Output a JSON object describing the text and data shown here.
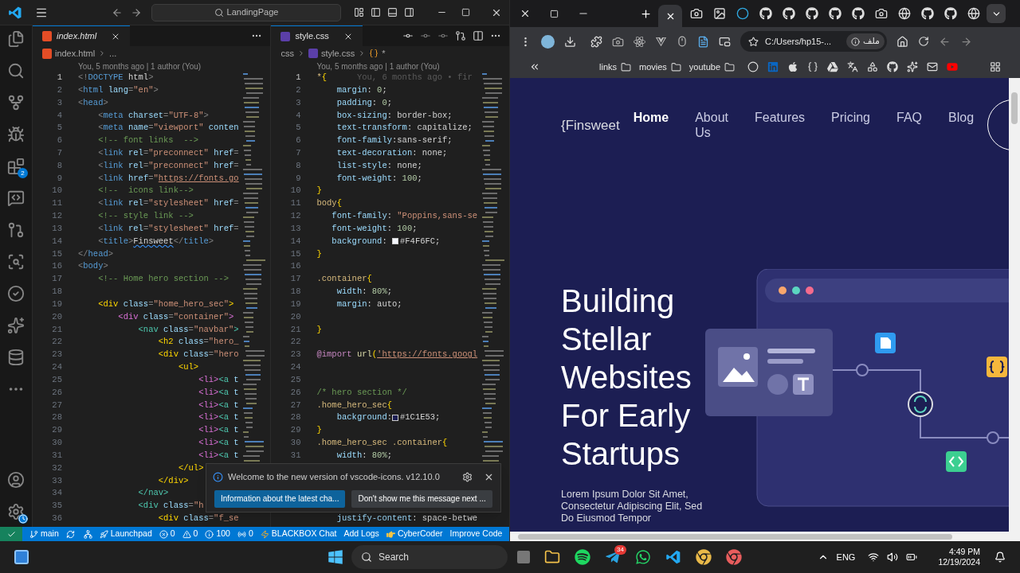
{
  "vscode": {
    "title_search": "LandingPage",
    "extensions_badge": "2",
    "editors": [
      {
        "tab": {
          "label": "index.html",
          "preview": true,
          "kind": "html"
        },
        "breadcrumb": [
          "index.html",
          "..."
        ],
        "blame": "You, 5 months ago | 1 author (You)",
        "lines": [
          {
            "n": "1",
            "current": true,
            "tokens": [
              {
                "kind": "p",
                "t": "<!"
              },
              {
                "kind": "tag",
                "t": "DOCTYPE"
              },
              {
                "kind": "tx",
                "t": " html"
              },
              {
                "kind": "p",
                "t": ">"
              }
            ]
          },
          {
            "n": "2",
            "current": false,
            "tokens": [
              {
                "kind": "p",
                "t": "<"
              },
              {
                "kind": "tag",
                "t": "html"
              },
              {
                "kind": "attr",
                "t": " lang"
              },
              {
                "kind": "p",
                "t": "="
              },
              {
                "kind": "str",
                "t": "\"en\""
              },
              {
                "kind": "p",
                "t": ">"
              }
            ]
          },
          {
            "n": "3",
            "current": false,
            "tokens": [
              {
                "kind": "p",
                "t": "<"
              },
              {
                "kind": "tag",
                "t": "head"
              },
              {
                "kind": "p",
                "t": ">"
              }
            ]
          },
          {
            "n": "4",
            "current": false,
            "tokens": [
              {
                "kind": "p",
                "t": "    <"
              },
              {
                "kind": "tag",
                "t": "meta"
              },
              {
                "kind": "attr",
                "t": " charset"
              },
              {
                "kind": "p",
                "t": "="
              },
              {
                "kind": "str",
                "t": "\"UTF-8\""
              },
              {
                "kind": "p",
                "t": ">"
              }
            ]
          },
          {
            "n": "5",
            "current": false,
            "tokens": [
              {
                "kind": "p",
                "t": "    <"
              },
              {
                "kind": "tag",
                "t": "meta"
              },
              {
                "kind": "attr",
                "t": " name"
              },
              {
                "kind": "p",
                "t": "="
              },
              {
                "kind": "str",
                "t": "\"viewport\""
              },
              {
                "kind": "attr",
                "t": " conten"
              }
            ]
          },
          {
            "n": "6",
            "current": false,
            "tokens": [
              {
                "kind": "cm",
                "t": "    <!-- font links  -->"
              }
            ]
          },
          {
            "n": "7",
            "current": false,
            "tokens": [
              {
                "kind": "p",
                "t": "    <"
              },
              {
                "kind": "tag",
                "t": "link"
              },
              {
                "kind": "attr",
                "t": " rel"
              },
              {
                "kind": "p",
                "t": "="
              },
              {
                "kind": "str",
                "t": "\"preconnect\""
              },
              {
                "kind": "attr",
                "t": " href"
              },
              {
                "kind": "p",
                "t": "="
              }
            ]
          },
          {
            "n": "8",
            "current": false,
            "tokens": [
              {
                "kind": "p",
                "t": "    <"
              },
              {
                "kind": "tag",
                "t": "link"
              },
              {
                "kind": "attr",
                "t": " rel"
              },
              {
                "kind": "p",
                "t": "="
              },
              {
                "kind": "str",
                "t": "\"preconnect\""
              },
              {
                "kind": "attr",
                "t": " href"
              },
              {
                "kind": "p",
                "t": "="
              }
            ]
          },
          {
            "n": "9",
            "current": false,
            "tokens": [
              {
                "kind": "p",
                "t": "    <"
              },
              {
                "kind": "tag",
                "t": "link"
              },
              {
                "kind": "attr",
                "t": " href"
              },
              {
                "kind": "p",
                "t": "="
              },
              {
                "kind": "str",
                "t": "\""
              },
              {
                "kind": "url",
                "t": "https://fonts.go"
              }
            ]
          },
          {
            "n": "10",
            "current": false,
            "tokens": [
              {
                "kind": "cm",
                "t": "    <!--  icons link-->"
              }
            ]
          },
          {
            "n": "11",
            "current": false,
            "tokens": [
              {
                "kind": "p",
                "t": "    <"
              },
              {
                "kind": "tag",
                "t": "link"
              },
              {
                "kind": "attr",
                "t": " rel"
              },
              {
                "kind": "p",
                "t": "="
              },
              {
                "kind": "str",
                "t": "\"stylesheet\""
              },
              {
                "kind": "attr",
                "t": " href"
              },
              {
                "kind": "p",
                "t": "="
              }
            ]
          },
          {
            "n": "12",
            "current": false,
            "tokens": [
              {
                "kind": "cm",
                "t": "    <!-- style link -->"
              }
            ]
          },
          {
            "n": "13",
            "current": false,
            "tokens": [
              {
                "kind": "p",
                "t": "    <"
              },
              {
                "kind": "tag",
                "t": "link"
              },
              {
                "kind": "attr",
                "t": " rel"
              },
              {
                "kind": "p",
                "t": "="
              },
              {
                "kind": "str",
                "t": "\"stylesheet\""
              },
              {
                "kind": "attr",
                "t": " href"
              },
              {
                "kind": "p",
                "t": "="
              }
            ]
          },
          {
            "n": "14",
            "current": false,
            "tokens": [
              {
                "kind": "p",
                "t": "    <"
              },
              {
                "kind": "tag",
                "t": "title"
              },
              {
                "kind": "p",
                "t": ">"
              },
              {
                "kind": "sq",
                "t": "Finsweet"
              },
              {
                "kind": "p",
                "t": "</"
              },
              {
                "kind": "tag",
                "t": "title"
              },
              {
                "kind": "p",
                "t": ">"
              }
            ]
          },
          {
            "n": "15",
            "current": false,
            "tokens": [
              {
                "kind": "p",
                "t": "</"
              },
              {
                "kind": "tag",
                "t": "head"
              },
              {
                "kind": "p",
                "t": ">"
              }
            ]
          },
          {
            "n": "16",
            "current": false,
            "tokens": [
              {
                "kind": "p",
                "t": "<"
              },
              {
                "kind": "tag",
                "t": "body"
              },
              {
                "kind": "p",
                "t": ">"
              }
            ]
          },
          {
            "n": "17",
            "current": false,
            "tokens": [
              {
                "kind": "cm",
                "t": "    <!-- Home hero section -->"
              }
            ]
          },
          {
            "n": "18",
            "current": false
          },
          {
            "n": "19",
            "current": false,
            "tokens": [
              {
                "kind": "gold",
                "t": "    <div"
              },
              {
                "kind": "attr",
                "t": " class"
              },
              {
                "kind": "p",
                "t": "="
              },
              {
                "kind": "str",
                "t": "\"home_hero_sec\""
              },
              {
                "kind": "gold",
                "t": ">"
              }
            ]
          },
          {
            "n": "20",
            "current": false,
            "tokens": [
              {
                "kind": "orch",
                "t": "        <div"
              },
              {
                "kind": "attr",
                "t": " class"
              },
              {
                "kind": "p",
                "t": "="
              },
              {
                "kind": "str",
                "t": "\"container\""
              },
              {
                "kind": "orch",
                "t": ">"
              }
            ]
          },
          {
            "n": "21",
            "current": false,
            "tokens": [
              {
                "kind": "teal",
                "t": "            <nav"
              },
              {
                "kind": "attr",
                "t": " class"
              },
              {
                "kind": "p",
                "t": "="
              },
              {
                "kind": "str",
                "t": "\"navbar\""
              },
              {
                "kind": "teal",
                "t": ">"
              }
            ]
          },
          {
            "n": "22",
            "current": false,
            "tokens": [
              {
                "kind": "gold",
                "t": "                <h2"
              },
              {
                "kind": "attr",
                "t": " class"
              },
              {
                "kind": "p",
                "t": "="
              },
              {
                "kind": "str",
                "t": "\"hero_"
              }
            ]
          },
          {
            "n": "23",
            "current": false,
            "tokens": [
              {
                "kind": "gold",
                "t": "                <div"
              },
              {
                "kind": "attr",
                "t": " class"
              },
              {
                "kind": "p",
                "t": "="
              },
              {
                "kind": "str",
                "t": "\"hero"
              }
            ]
          },
          {
            "n": "24",
            "current": false,
            "tokens": [
              {
                "kind": "gold",
                "t": "                    <ul>"
              }
            ]
          },
          {
            "n": "25",
            "current": false,
            "tokens": [
              {
                "kind": "orch",
                "t": "                        <li>"
              },
              {
                "kind": "teal",
                "t": "<a"
              },
              {
                "kind": "attr",
                "t": " t"
              }
            ]
          },
          {
            "n": "26",
            "current": false,
            "tokens": [
              {
                "kind": "orch",
                "t": "                        <li>"
              },
              {
                "kind": "teal",
                "t": "<a"
              },
              {
                "kind": "attr",
                "t": " t"
              }
            ]
          },
          {
            "n": "27",
            "current": false,
            "tokens": [
              {
                "kind": "orch",
                "t": "                        <li>"
              },
              {
                "kind": "teal",
                "t": "<a"
              },
              {
                "kind": "attr",
                "t": " t"
              }
            ]
          },
          {
            "n": "28",
            "current": false,
            "tokens": [
              {
                "kind": "orch",
                "t": "                        <li>"
              },
              {
                "kind": "teal",
                "t": "<a"
              },
              {
                "kind": "attr",
                "t": " t"
              }
            ]
          },
          {
            "n": "29",
            "current": false,
            "tokens": [
              {
                "kind": "orch",
                "t": "                        <li>"
              },
              {
                "kind": "teal",
                "t": "<a"
              },
              {
                "kind": "attr",
                "t": " t"
              }
            ]
          },
          {
            "n": "30",
            "current": false,
            "tokens": [
              {
                "kind": "orch",
                "t": "                        <li>"
              },
              {
                "kind": "teal",
                "t": "<a"
              },
              {
                "kind": "attr",
                "t": " t"
              }
            ]
          },
          {
            "n": "31",
            "current": false,
            "tokens": [
              {
                "kind": "orch",
                "t": "                        <li>"
              },
              {
                "kind": "teal",
                "t": "<a"
              },
              {
                "kind": "attr",
                "t": " t"
              }
            ]
          },
          {
            "n": "32",
            "current": false,
            "tokens": [
              {
                "kind": "gold",
                "t": "                    </ul>"
              }
            ]
          },
          {
            "n": "33",
            "current": false,
            "tokens": [
              {
                "kind": "gold",
                "t": "                </div>"
              }
            ]
          },
          {
            "n": "34",
            "current": false,
            "tokens": [
              {
                "kind": "teal",
                "t": "            </nav>"
              }
            ]
          },
          {
            "n": "35",
            "current": false,
            "tokens": [
              {
                "kind": "teal",
                "t": "            <div"
              },
              {
                "kind": "attr",
                "t": " class"
              },
              {
                "kind": "p",
                "t": "="
              },
              {
                "kind": "str",
                "t": "\"h"
              }
            ]
          },
          {
            "n": "36",
            "current": false,
            "tokens": [
              {
                "kind": "gold",
                "t": "                <div"
              },
              {
                "kind": "attr",
                "t": " class"
              },
              {
                "kind": "p",
                "t": "="
              },
              {
                "kind": "str",
                "t": "\"f_se"
              }
            ]
          }
        ]
      },
      {
        "tab": {
          "label": "style.css",
          "preview": false,
          "kind": "css"
        },
        "breadcrumb": [
          "css",
          "style.css",
          "*"
        ],
        "blame": "You, 5 months ago | 1 author (You)",
        "lines": [
          {
            "n": "1",
            "current": true,
            "tokens": [
              {
                "kind": "sel",
                "t": "*"
              },
              {
                "kind": "gold",
                "t": "{"
              },
              {
                "kind": "ghost",
                "t": "      You, 6 months ago • fir"
              }
            ]
          },
          {
            "n": "2",
            "current": false,
            "tokens": [
              {
                "kind": "prop",
                "t": "    margin"
              },
              {
                "kind": "tx",
                "t": ": "
              },
              {
                "kind": "num",
                "t": "0"
              },
              {
                "kind": "tx",
                "t": ";"
              }
            ]
          },
          {
            "n": "3",
            "current": false,
            "tokens": [
              {
                "kind": "prop",
                "t": "    padding"
              },
              {
                "kind": "tx",
                "t": ": "
              },
              {
                "kind": "num",
                "t": "0"
              },
              {
                "kind": "tx",
                "t": ";"
              }
            ]
          },
          {
            "n": "4",
            "current": false,
            "tokens": [
              {
                "kind": "prop",
                "t": "    box-sizing"
              },
              {
                "kind": "tx",
                "t": ": border-box;"
              }
            ]
          },
          {
            "n": "5",
            "current": false,
            "tokens": [
              {
                "kind": "prop",
                "t": "    text-transform"
              },
              {
                "kind": "tx",
                "t": ": capitalize;"
              }
            ]
          },
          {
            "n": "6",
            "current": false,
            "tokens": [
              {
                "kind": "prop",
                "t": "    font-family"
              },
              {
                "kind": "tx",
                "t": ":sans-serif;"
              }
            ]
          },
          {
            "n": "7",
            "current": false,
            "tokens": [
              {
                "kind": "prop",
                "t": "    text-decoration"
              },
              {
                "kind": "tx",
                "t": ": none;"
              }
            ]
          },
          {
            "n": "8",
            "current": false,
            "tokens": [
              {
                "kind": "prop",
                "t": "    list-style"
              },
              {
                "kind": "tx",
                "t": ": none;"
              }
            ]
          },
          {
            "n": "9",
            "current": false,
            "tokens": [
              {
                "kind": "prop",
                "t": "    font-weight"
              },
              {
                "kind": "tx",
                "t": ": "
              },
              {
                "kind": "num",
                "t": "100"
              },
              {
                "kind": "tx",
                "t": ";"
              }
            ]
          },
          {
            "n": "10",
            "current": false,
            "tokens": [
              {
                "kind": "gold",
                "t": "}"
              }
            ]
          },
          {
            "n": "11",
            "current": false,
            "tokens": [
              {
                "kind": "sel",
                "t": "body"
              },
              {
                "kind": "gold",
                "t": "{"
              }
            ]
          },
          {
            "n": "12",
            "current": false,
            "tokens": [
              {
                "kind": "prop",
                "t": "   font-family"
              },
              {
                "kind": "tx",
                "t": ": "
              },
              {
                "kind": "str",
                "t": "\"Poppins,sans-se"
              }
            ]
          },
          {
            "n": "13",
            "current": false,
            "tokens": [
              {
                "kind": "prop",
                "t": "   font-weight"
              },
              {
                "kind": "tx",
                "t": ": "
              },
              {
                "kind": "num",
                "t": "100"
              },
              {
                "kind": "tx",
                "t": ";"
              }
            ]
          },
          {
            "n": "14",
            "current": false,
            "tokens": [
              {
                "kind": "prop",
                "t": "   background"
              },
              {
                "kind": "tx",
                "t": ": "
              },
              {
                "kind": "swatch",
                "t": "#F4F6FC",
                "color": "#f4f6fc"
              },
              {
                "kind": "tx",
                "t": ";"
              }
            ]
          },
          {
            "n": "15",
            "current": false,
            "tokens": [
              {
                "kind": "gold",
                "t": "}"
              }
            ]
          },
          {
            "n": "16",
            "current": false
          },
          {
            "n": "17",
            "current": false,
            "tokens": [
              {
                "kind": "sel",
                "t": ".container"
              },
              {
                "kind": "gold",
                "t": "{"
              }
            ]
          },
          {
            "n": "18",
            "current": false,
            "tokens": [
              {
                "kind": "prop",
                "t": "    width"
              },
              {
                "kind": "tx",
                "t": ": "
              },
              {
                "kind": "num",
                "t": "80%"
              },
              {
                "kind": "tx",
                "t": ";"
              }
            ]
          },
          {
            "n": "19",
            "current": false,
            "tokens": [
              {
                "kind": "prop",
                "t": "    margin"
              },
              {
                "kind": "tx",
                "t": ": auto;"
              }
            ]
          },
          {
            "n": "20",
            "current": false
          },
          {
            "n": "21",
            "current": false,
            "tokens": [
              {
                "kind": "gold",
                "t": "}"
              }
            ]
          },
          {
            "n": "22",
            "current": false
          },
          {
            "n": "23",
            "current": false,
            "tokens": [
              {
                "kind": "kw",
                "t": "@import"
              },
              {
                "kind": "fn",
                "t": " url"
              },
              {
                "kind": "gold",
                "t": "("
              },
              {
                "kind": "url",
                "t": "'https://fonts.googl"
              }
            ]
          },
          {
            "n": "24",
            "current": false
          },
          {
            "n": "25",
            "current": false
          },
          {
            "n": "26",
            "current": false,
            "tokens": [
              {
                "kind": "cm",
                "t": "/* hero section */"
              }
            ]
          },
          {
            "n": "27",
            "current": false,
            "tokens": [
              {
                "kind": "sel",
                "t": ".home_hero_sec"
              },
              {
                "kind": "gold",
                "t": "{"
              }
            ]
          },
          {
            "n": "28",
            "current": false,
            "tokens": [
              {
                "kind": "prop",
                "t": "    background"
              },
              {
                "kind": "tx",
                "t": ":"
              },
              {
                "kind": "swatch",
                "t": "#1C1E53",
                "color": "#1c1e53"
              },
              {
                "kind": "tx",
                "t": ";"
              }
            ]
          },
          {
            "n": "29",
            "current": false,
            "tokens": [
              {
                "kind": "gold",
                "t": "}"
              }
            ]
          },
          {
            "n": "30",
            "current": false,
            "tokens": [
              {
                "kind": "sel",
                "t": ".home_hero_sec .container"
              },
              {
                "kind": "gold",
                "t": "{"
              }
            ]
          },
          {
            "n": "31",
            "current": false,
            "tokens": [
              {
                "kind": "prop",
                "t": "    width"
              },
              {
                "kind": "tx",
                "t": ": "
              },
              {
                "kind": "num",
                "t": "80%"
              },
              {
                "kind": "tx",
                "t": ";"
              }
            ]
          }
        ],
        "partial_line": [
          {
            "kind": "prop",
            "t": "    justify-content"
          },
          {
            "kind": "tx",
            "t": ": space-betwe"
          }
        ]
      }
    ],
    "notification": {
      "message": "Welcome to the new version of vscode-icons. v12.10.0",
      "buttons": [
        "Information about the latest cha...",
        "Don't show me this message next ..."
      ]
    },
    "status_bar": [
      {
        "kind": "branch",
        "text": "main"
      },
      {
        "kind": "launchpad",
        "text": "Launchpad"
      },
      {
        "kind": "error",
        "text": "0"
      },
      {
        "kind": "warning",
        "text": "0"
      },
      {
        "kind": "info",
        "text": "100"
      },
      {
        "kind": "ports",
        "text": "0"
      },
      {
        "kind": "blackbox",
        "text": "BLACKBOX Chat"
      },
      {
        "kind": "plain",
        "text": "Add Logs"
      },
      {
        "kind": "cyber",
        "text": "CyberCoder"
      },
      {
        "kind": "plain",
        "text": "Improve Code"
      }
    ]
  },
  "browser": {
    "address": "C:/Users/hp15-...",
    "address_chip": "ملف",
    "bookmarks": [
      {
        "label": "links"
      },
      {
        "label": "movies"
      },
      {
        "label": "youtube"
      }
    ],
    "page": {
      "logo": "{Finsweet",
      "nav": [
        {
          "label": "Home",
          "selected": true
        },
        {
          "label": "About Us",
          "selected": false
        },
        {
          "label": "Features",
          "selected": false
        },
        {
          "label": "Pricing",
          "selected": false
        },
        {
          "label": "FAQ",
          "selected": false
        },
        {
          "label": "Blog",
          "selected": false
        }
      ],
      "headline": "Building Stellar Websites For Early Startups",
      "intro": "Lorem Ipsum Dolor Sit Amet, Consectetur Adipiscing Elit, Sed Do Eiusmod Tempor"
    }
  },
  "taskbar": {
    "search": "Search",
    "telegram_badge": "34",
    "language": "ENG",
    "time": "4:49 PM",
    "date": "12/19/2024"
  }
}
